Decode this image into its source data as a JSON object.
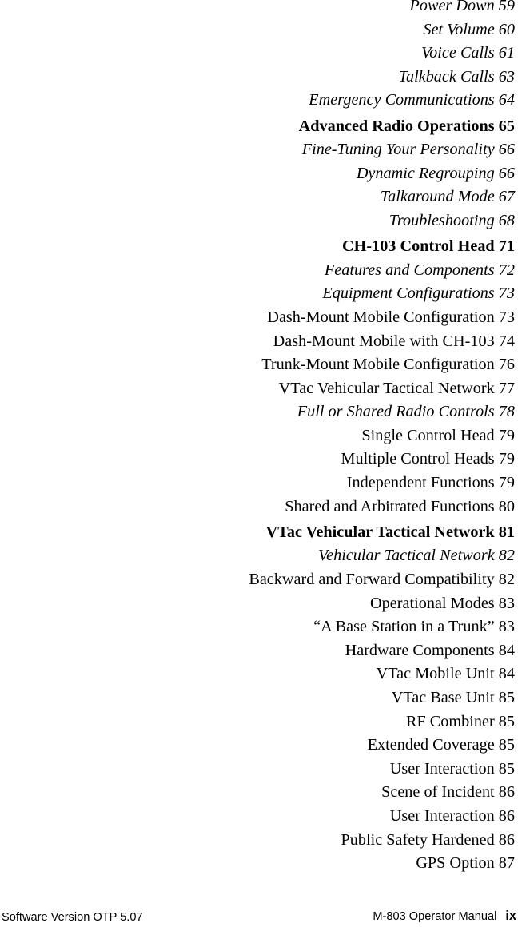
{
  "document": {
    "type": "table-of-contents",
    "page_label": "ix"
  },
  "toc": {
    "entries": [
      {
        "title": "Power Down",
        "page": "59",
        "level": 2
      },
      {
        "title": "Set Volume",
        "page": "60",
        "level": 2
      },
      {
        "title": "Voice Calls",
        "page": "61",
        "level": 2
      },
      {
        "title": "Talkback Calls",
        "page": "63",
        "level": 2
      },
      {
        "title": "Emergency Communications",
        "page": "64",
        "level": 2
      },
      {
        "title": "Advanced Radio Operations",
        "page": "65",
        "level": 1
      },
      {
        "title": "Fine-Tuning Your Personality",
        "page": "66",
        "level": 2
      },
      {
        "title": "Dynamic Regrouping",
        "page": "66",
        "level": 2
      },
      {
        "title": "Talkaround Mode",
        "page": "67",
        "level": 2
      },
      {
        "title": "Troubleshooting",
        "page": "68",
        "level": 2
      },
      {
        "title": "CH-103 Control Head",
        "page": "71",
        "level": 1
      },
      {
        "title": "Features and Components",
        "page": "72",
        "level": 2
      },
      {
        "title": "Equipment Configurations",
        "page": "73",
        "level": 2
      },
      {
        "title": "Dash-Mount Mobile Configuration",
        "page": "73",
        "level": 3
      },
      {
        "title": "Dash-Mount Mobile with CH-103",
        "page": "74",
        "level": 3
      },
      {
        "title": "Trunk-Mount Mobile Configuration",
        "page": "76",
        "level": 3
      },
      {
        "title": "VTac Vehicular Tactical Network",
        "page": "77",
        "level": 3
      },
      {
        "title": "Full or Shared Radio Controls",
        "page": "78",
        "level": 2
      },
      {
        "title": "Single Control Head",
        "page": "79",
        "level": 3
      },
      {
        "title": "Multiple Control Heads",
        "page": "79",
        "level": 3
      },
      {
        "title": "Independent Functions",
        "page": "79",
        "level": 3
      },
      {
        "title": "Shared and Arbitrated Functions",
        "page": "80",
        "level": 3
      },
      {
        "title": "VTac Vehicular Tactical Network",
        "page": "81",
        "level": 1
      },
      {
        "title": "Vehicular Tactical Network",
        "page": "82",
        "level": 2
      },
      {
        "title": "Backward and Forward Compatibility",
        "page": "82",
        "level": 3
      },
      {
        "title": "Operational Modes",
        "page": "83",
        "level": 3
      },
      {
        "title": "“A Base Station in a Trunk”",
        "page": "83",
        "level": 3
      },
      {
        "title": "Hardware Components",
        "page": "84",
        "level": 3
      },
      {
        "title": "VTac Mobile Unit",
        "page": "84",
        "level": 3
      },
      {
        "title": "VTac Base Unit",
        "page": "85",
        "level": 3
      },
      {
        "title": "RF Combiner",
        "page": "85",
        "level": 3
      },
      {
        "title": "Extended Coverage",
        "page": "85",
        "level": 3
      },
      {
        "title": "User Interaction",
        "page": "85",
        "level": 3
      },
      {
        "title": "Scene of Incident",
        "page": "86",
        "level": 3
      },
      {
        "title": "User Interaction",
        "page": "86",
        "level": 3
      },
      {
        "title": "Public Safety Hardened",
        "page": "86",
        "level": 3
      },
      {
        "title": "GPS Option",
        "page": "87",
        "level": 3
      }
    ]
  },
  "footer": {
    "software_version": "Software Version OTP 5.07",
    "manual_title": "M-803 Operator Manual",
    "page_number": "ix"
  }
}
